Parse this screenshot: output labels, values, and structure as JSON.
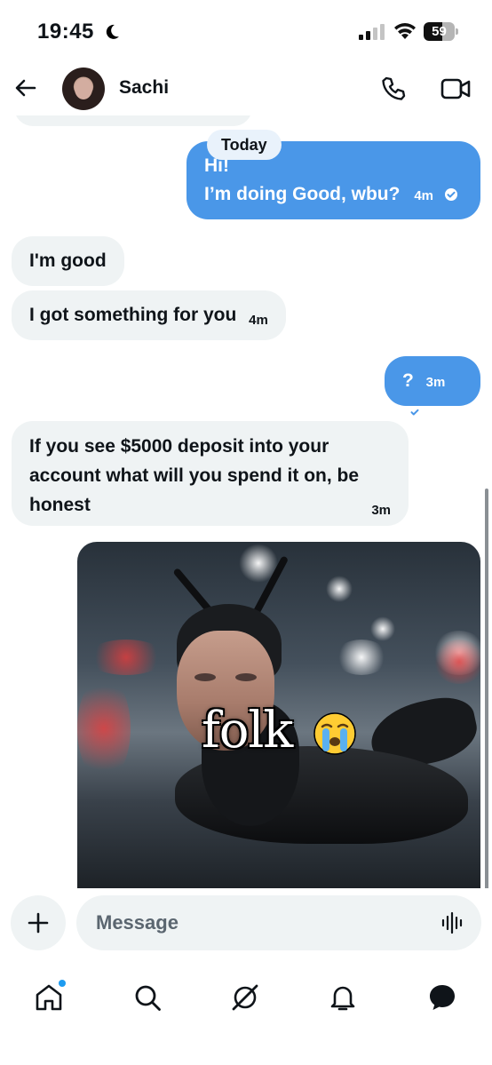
{
  "status_bar": {
    "time": "19:45",
    "battery": "59",
    "battery_level": 0.59
  },
  "header": {
    "contact_name": "Sachi"
  },
  "chat": {
    "date_separator": "Today",
    "messages": [
      {
        "direction": "out",
        "lines": [
          "Hi!",
          "I’m doing Good, wbu?"
        ],
        "time": "4m",
        "read": true
      },
      {
        "direction": "in",
        "text": "I'm good"
      },
      {
        "direction": "in",
        "text": "I got something for you",
        "time": "4m"
      },
      {
        "direction": "out",
        "text": "?",
        "time": "3m",
        "read": true
      },
      {
        "direction": "in",
        "lines": [
          "If you see $5000 deposit into your",
          "account what will you spend it on, be",
          "honest"
        ],
        "time": "3m"
      },
      {
        "direction": "out",
        "type": "image",
        "caption": "folk",
        "emoji": "😭"
      }
    ]
  },
  "composer": {
    "placeholder": "Message",
    "value": ""
  },
  "nav": {
    "items": [
      "home-icon",
      "search-icon",
      "grok-icon",
      "notifications-icon",
      "messages-icon"
    ],
    "active": "messages-icon"
  },
  "colors": {
    "outgoing_bubble": "#4a97e8",
    "incoming_bubble": "#eff3f4",
    "accent": "#1d9bf0"
  }
}
